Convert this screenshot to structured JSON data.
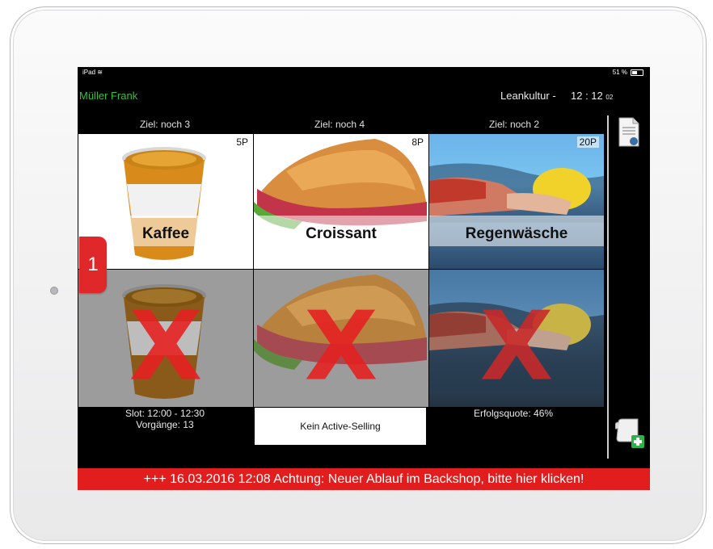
{
  "status": {
    "device": "iPad",
    "wifi_icon": "wifi-icon",
    "battery": "51 %"
  },
  "header": {
    "user": "Müller Frank",
    "org": "Leankultur -",
    "time": "12 : 12",
    "seconds": "02"
  },
  "targets": [
    "Ziel: noch 3",
    "Ziel: noch 4",
    "Ziel: noch 2"
  ],
  "products": [
    {
      "name": "Kaffee",
      "points": "5P"
    },
    {
      "name": "Croissant",
      "points": "8P"
    },
    {
      "name": "Regenwäsche",
      "points": "20P"
    }
  ],
  "slot_badge": "1",
  "footer": {
    "slot": "Slot: 12:00 - 12:30",
    "processes": "Vorgänge: 13",
    "active_selling": "Kein Active-Selling",
    "success_rate": "Erfolgsquote: 46%"
  },
  "ticker": "+++ 16.03.2016 12:08 Achtung: Neuer Ablauf im Backshop, bitte hier klicken!",
  "colors": {
    "accent_red": "#e21d1d",
    "user_green": "#3bbf3b",
    "background": "#000000"
  }
}
